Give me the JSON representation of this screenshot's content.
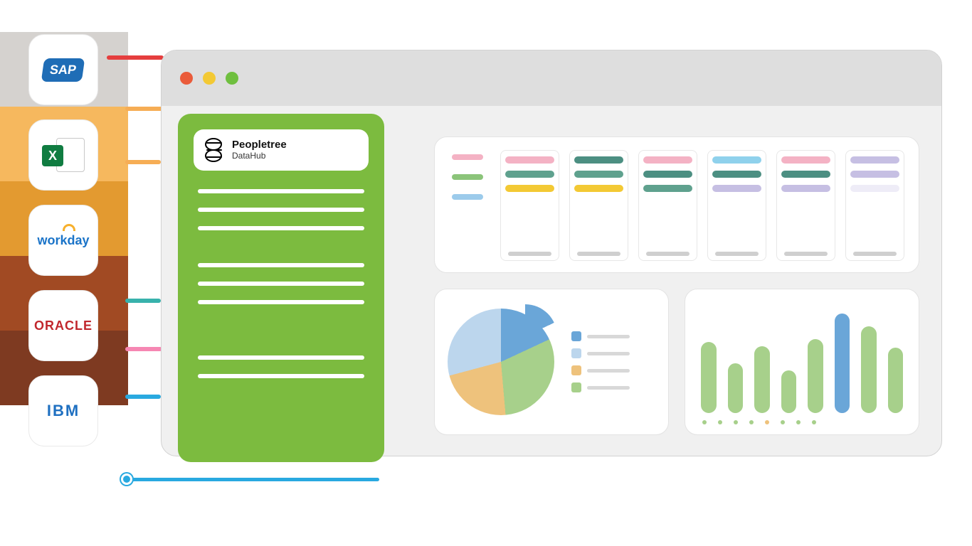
{
  "sources": {
    "sap": {
      "label": "SAP"
    },
    "excel": {
      "label": "X"
    },
    "workday": {
      "label": "workday"
    },
    "oracle": {
      "label": "ORACLE"
    },
    "ibm": {
      "label": "IBM"
    }
  },
  "datahub": {
    "title": "Peopletree",
    "subtitle": "DataHub"
  },
  "colors": {
    "accent_green": "#7cbb3f",
    "accent_blue": "#29a9e0",
    "window_bg": "#f0f0f0"
  },
  "chart_data": [
    {
      "type": "table",
      "title": "timeline grid",
      "row_colors": [
        "pink",
        "green",
        "blue"
      ],
      "columns": 6
    },
    {
      "type": "pie",
      "title": "",
      "series": [
        {
          "name": "blue",
          "value": 18,
          "color": "#6aa6d8"
        },
        {
          "name": "green",
          "value": 31,
          "color": "#a7d08b"
        },
        {
          "name": "orange",
          "value": 22,
          "color": "#eec27c"
        },
        {
          "name": "light-blue",
          "value": 29,
          "color": "#bcd6ed"
        }
      ],
      "legend_order": [
        "blue",
        "light-blue",
        "orange",
        "green"
      ]
    },
    {
      "type": "bar",
      "title": "",
      "categories": [
        "",
        "",
        "",
        "",
        "",
        "",
        "",
        ""
      ],
      "values": [
        100,
        70,
        94,
        60,
        104,
        140,
        122,
        92
      ],
      "highlight_index": 5,
      "ylim": [
        0,
        140
      ],
      "bar_color": "#a7d08b",
      "highlight_color": "#6aa6d8"
    }
  ]
}
